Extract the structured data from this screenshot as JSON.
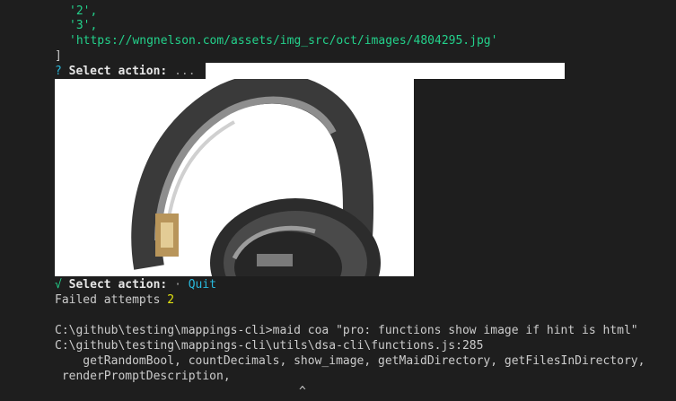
{
  "terminal": {
    "array_items": [
      "'2',",
      "'3',",
      "'https://wngnelson.com/assets/img_src/oct/images/4804295.jpg'"
    ],
    "array_close": "]",
    "prompt1": {
      "marker": "?",
      "label": "Select action:",
      "value": "..."
    },
    "image": {
      "subject": "headphones",
      "icon": "headphones-image"
    },
    "prompt2": {
      "marker": "√",
      "label": "Select action:",
      "separator": "·",
      "value": "Quit"
    },
    "failed": {
      "label": "Failed attempts",
      "count": "2"
    },
    "command_line": "C:\\github\\testing\\mappings-cli>maid coa \"pro: functions show image if hint is html\"",
    "error_path": "C:\\github\\testing\\mappings-cli\\utils\\dsa-cli\\functions.js:285",
    "error_code_1": "    getRandomBool, countDecimals, show_image, getMaidDirectory, getFilesInDirectory,",
    "error_code_2": " renderPromptDescription,",
    "caret": "^"
  },
  "colors": {
    "background": "#1e1e1e",
    "text": "#cccccc",
    "string_green": "#23d18b",
    "prompt_cyan": "#29b8db",
    "count_yellow": "#e5e510"
  }
}
